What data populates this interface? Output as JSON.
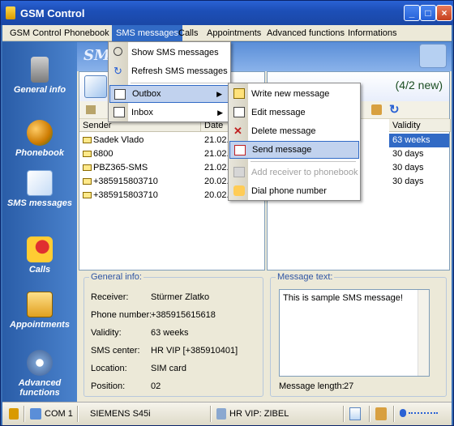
{
  "window": {
    "title": "GSM Control"
  },
  "menubar": [
    "GSM Control",
    "Phonebook",
    "SMS messages",
    "Calls",
    "Appointments",
    "Advanced functions",
    "Informations"
  ],
  "sidebar": {
    "items": [
      {
        "label": "General info",
        "icon": "phone-icon"
      },
      {
        "label": "Phonebook",
        "icon": "people-icon"
      },
      {
        "label": "SMS messages",
        "icon": "envelope-icon"
      },
      {
        "label": "Calls",
        "icon": "call-question-icon"
      },
      {
        "label": "Appointments",
        "icon": "calendar-icon"
      },
      {
        "label": "Advanced functions",
        "icon": "tools-icon"
      }
    ]
  },
  "banner": {
    "title": "SMS"
  },
  "inbox": {
    "count": "(4/2 new)",
    "columns": [
      "Sender",
      "Date"
    ],
    "rows": [
      {
        "sender": "Sadek Vlado",
        "date": "21.02."
      },
      {
        "sender": "6800",
        "date": "21.02."
      },
      {
        "sender": "PBZ365-SMS",
        "date": "21.02."
      },
      {
        "sender": "+385915803710",
        "date": "20.02."
      },
      {
        "sender": "+385915803710",
        "date": "20.02."
      }
    ]
  },
  "outbox": {
    "columns": [
      "Validity"
    ],
    "validity": [
      "63 weeks",
      "30 days",
      "30 days",
      "30 days"
    ]
  },
  "general_info": {
    "title": "General info:",
    "fields": [
      {
        "label": "Receiver:",
        "value": "Stürmer Zlatko"
      },
      {
        "label": "Phone number:",
        "value": "+385915615618"
      },
      {
        "label": "Validity:",
        "value": "63 weeks"
      },
      {
        "label": "SMS center:",
        "value": "HR VIP [+385910401]"
      },
      {
        "label": "Location:",
        "value": "SIM card"
      },
      {
        "label": "Position:",
        "value": "02"
      }
    ]
  },
  "message_text": {
    "title": "Message text:",
    "text": "This is sample SMS message!",
    "length_label": "Message length:",
    "length": "27"
  },
  "statusbar": {
    "port": "COM 1",
    "device": "SIEMENS S45i",
    "network": "HR VIP:  ZIBEL"
  },
  "menu_sms": {
    "items": [
      "Show SMS messages",
      "Refresh SMS messages",
      "Outbox",
      "Inbox"
    ]
  },
  "menu_outbox": {
    "items": [
      "Write new message",
      "Edit message",
      "Delete message",
      "Send message",
      "Add receiver to phonebook",
      "Dial phone number"
    ]
  },
  "colors": {
    "highlight": "#316ac5",
    "menu_hover": "#c1d2ee",
    "sidebar": "#2a5da8"
  }
}
